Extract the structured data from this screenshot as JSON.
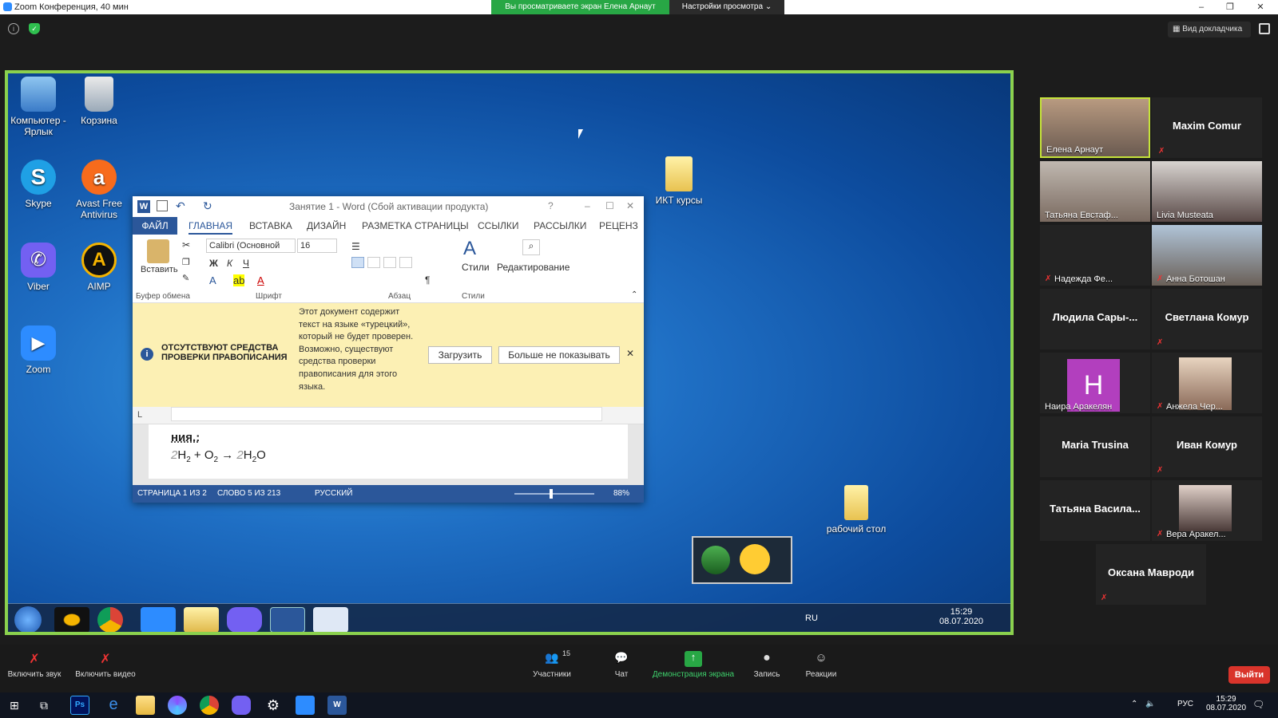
{
  "zoom": {
    "window_title": "Zoom Конференция, 40 мин",
    "share_banner": "Вы просматриваете экран Елена Арнаут",
    "view_options": "Настройки просмотра",
    "speaker_view": "Вид докладчика",
    "toolbar": {
      "unmute": "Включить звук",
      "start_video": "Включить видео",
      "participants": "Участники",
      "participants_count": "15",
      "chat": "Чат",
      "share_screen": "Демонстрация экрана",
      "record": "Запись",
      "reactions": "Реакции",
      "leave": "Выйти"
    }
  },
  "participants": [
    {
      "name": "Елена Арнаут",
      "video": true,
      "active": true
    },
    {
      "name": "Maxim Comur",
      "video": false
    },
    {
      "name": "Татьяна Евстаф...",
      "video": true
    },
    {
      "name": "Livia Musteata",
      "video": true
    },
    {
      "name": "Надежда Фе...",
      "video": false
    },
    {
      "name": "Анна Ботошан",
      "video": true
    },
    {
      "name": "Людила Сары-...",
      "video": false
    },
    {
      "name": "Светлана Комур",
      "video": false
    },
    {
      "name": "Наира Аракелян",
      "video": false,
      "avatar_letter": "H"
    },
    {
      "name": "Анжела Чер...",
      "video": true
    },
    {
      "name": "Maria Trusina",
      "video": false
    },
    {
      "name": "Иван Комур",
      "video": false
    },
    {
      "name": "Татьяна Васила...",
      "video": false
    },
    {
      "name": "Вера Аракел...",
      "video": true
    },
    {
      "name": "Оксана Мавроди",
      "video": false
    }
  ],
  "desktop": {
    "icons": [
      {
        "label": "Компьютер - Ярлык"
      },
      {
        "label": "Корзина"
      },
      {
        "label": "Skype"
      },
      {
        "label": "Avast Free Antivirus"
      },
      {
        "label": "Viber"
      },
      {
        "label": "AIMP"
      },
      {
        "label": "Zoom"
      },
      {
        "label": "ИКТ курсы"
      },
      {
        "label": "рабочий стол"
      }
    ],
    "clock_time": "15:29",
    "clock_date": "08.07.2020",
    "lang": "RU"
  },
  "word": {
    "title": "Занятие 1 - Word (Сбой активации продукта)",
    "tabs": [
      "ФАЙЛ",
      "ГЛАВНАЯ",
      "ВСТАВКА",
      "ДИЗАЙН",
      "РАЗМЕТКА СТРАНИЦЫ",
      "ССЫЛКИ",
      "РАССЫЛКИ",
      "РЕЦЕНЗ"
    ],
    "font_name": "Calibri (Основной",
    "font_size": "16",
    "paste_label": "Вставить",
    "styles_label": "Стили",
    "editing_label": "Редактирование",
    "groups": [
      "Буфер обмена",
      "Шрифт",
      "Абзац",
      "Стили"
    ],
    "infobar_title": "ОТСУТСТВУЮТ СРЕДСТВА ПРОВЕРКИ ПРАВОПИСАНИЯ",
    "infobar_text": "Этот документ содержит текст на языке «турецкий», который не будет проверен. Возможно, существуют средства проверки правописания для этого языка.",
    "download_button": "Загрузить",
    "dont_show_button": "Больше не показывать",
    "doc_line1": "ния.:",
    "status_page": "СТРАНИЦА 1 ИЗ 2",
    "status_words": "СЛОВО 5 ИЗ 213",
    "status_lang": "РУССКИЙ",
    "zoom_level": "88%"
  },
  "win10": {
    "time": "15:29",
    "date": "08.07.2020",
    "lang": "РУС"
  }
}
